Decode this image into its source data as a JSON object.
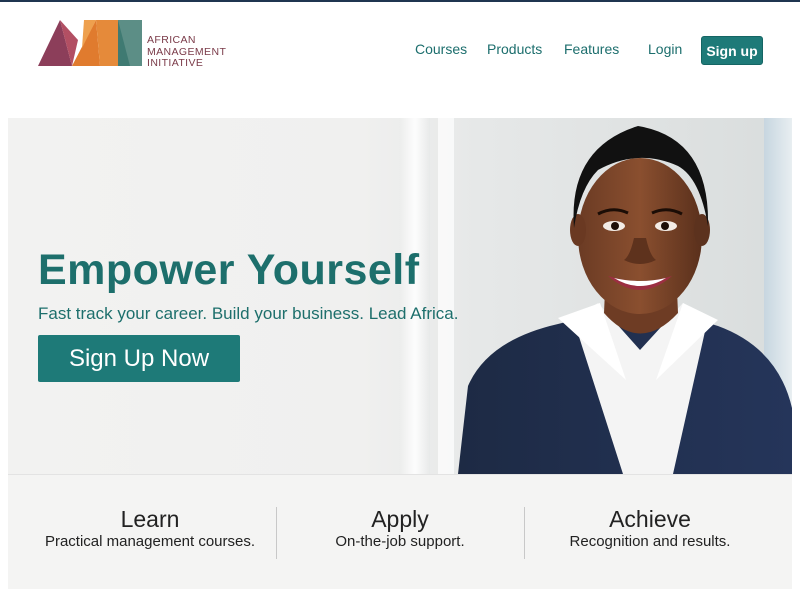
{
  "brand": {
    "logo_lines": [
      "AFRICAN",
      "MANAGEMENT",
      "INITIATIVE"
    ]
  },
  "nav": {
    "items": [
      {
        "label": "Courses"
      },
      {
        "label": "Products"
      },
      {
        "label": "Features"
      },
      {
        "label": "Login"
      }
    ],
    "signup_label": "Sign up"
  },
  "hero": {
    "title": "Empower Yourself",
    "subtitle": "Fast track your career. Build your business. Lead Africa.",
    "cta_label": "Sign Up Now"
  },
  "features": [
    {
      "title": "Learn",
      "desc": "Practical management courses."
    },
    {
      "title": "Apply",
      "desc": "On-the-job support."
    },
    {
      "title": "Achieve",
      "desc": "Recognition and results."
    }
  ],
  "colors": {
    "accent": "#1e7a78",
    "logo_red": "#b0485c",
    "logo_orange": "#e58a3a",
    "logo_teal": "#4f8c82"
  }
}
